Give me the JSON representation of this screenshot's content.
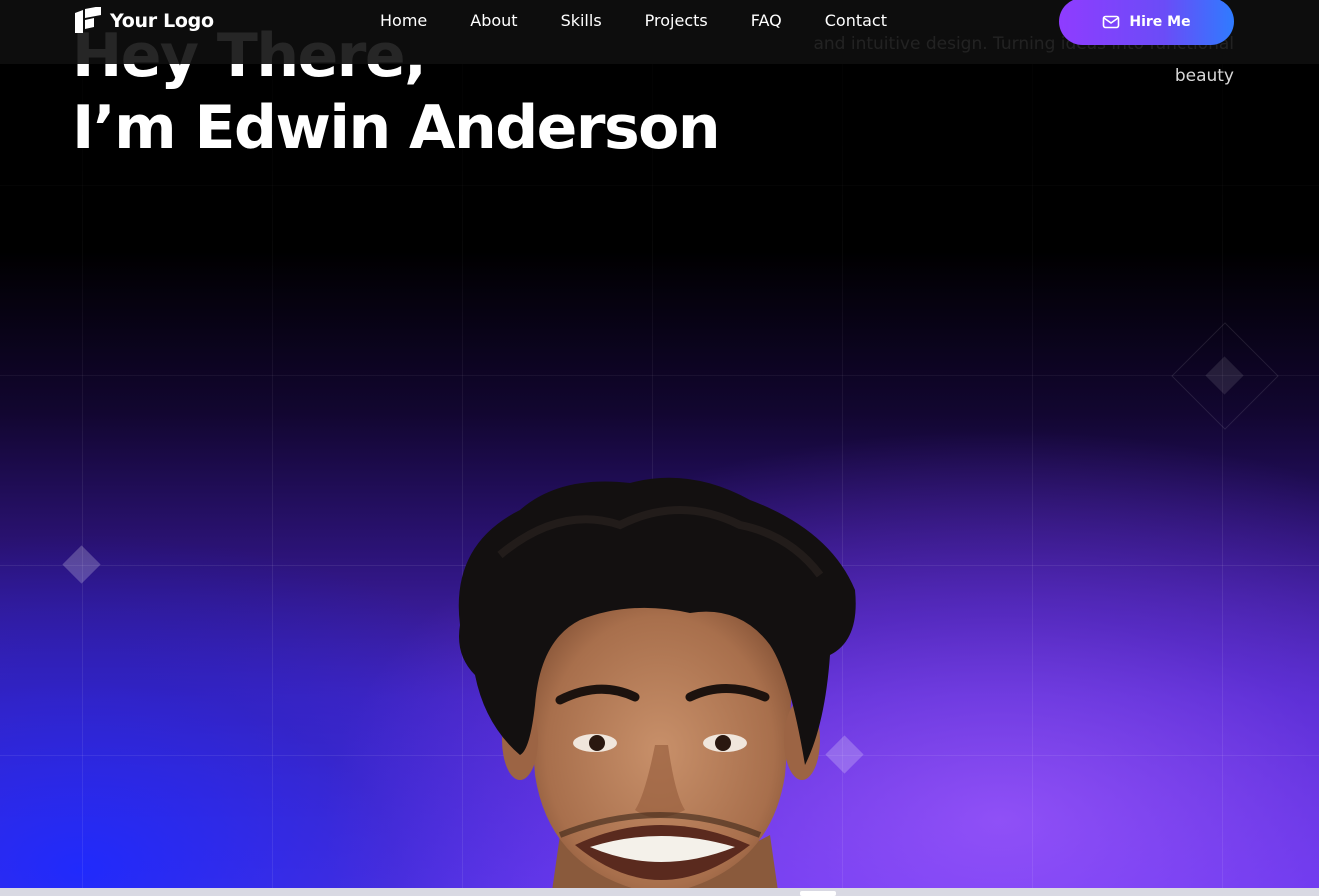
{
  "header": {
    "logo_text": "Your Logo",
    "nav": [
      "Home",
      "About",
      "Skills",
      "Projects",
      "FAQ",
      "Contact"
    ],
    "cta_label": "Hire Me",
    "cta_icon": "mail-icon"
  },
  "hero": {
    "title_line1": "Hey There,",
    "title_line2": "I’m Edwin Anderson",
    "description": "and intuitive design. Turning ideas into functional beauty"
  },
  "colors": {
    "accent_purple": "#8f3cff",
    "accent_blue": "#2f7bff",
    "background": "#000000",
    "glow_purple": "#6a3af0",
    "glow_blue": "#1428ff"
  }
}
